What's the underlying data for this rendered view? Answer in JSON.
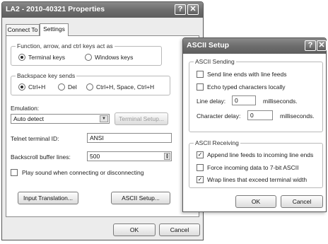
{
  "properties_dialog": {
    "title": "LA2 - 2010-40321 Properties",
    "help_button": "?",
    "close_button": "✕",
    "tabs": [
      {
        "label": "Connect To",
        "active": false
      },
      {
        "label": "Settings",
        "active": true
      }
    ],
    "function_keys": {
      "legend": "Function, arrow, and ctrl keys act as",
      "options": [
        {
          "label": "Terminal keys",
          "selected": true
        },
        {
          "label": "Windows keys",
          "selected": false
        }
      ]
    },
    "backspace": {
      "legend": "Backspace key sends",
      "options": [
        {
          "label": "Ctrl+H",
          "selected": true
        },
        {
          "label": "Del",
          "selected": false
        },
        {
          "label": "Ctrl+H, Space, Ctrl+H",
          "selected": false
        }
      ]
    },
    "emulation": {
      "label": "Emulation:",
      "value": "Auto detect",
      "terminal_setup_label": "Terminal Setup..."
    },
    "telnet_id": {
      "label": "Telnet terminal ID:",
      "value": "ANSI"
    },
    "backscroll": {
      "label": "Backscroll buffer lines:",
      "value": "500"
    },
    "play_sound": {
      "label": "Play sound when connecting or disconnecting",
      "checked": false
    },
    "input_translation_label": "Input Translation...",
    "ascii_setup_label": "ASCII Setup...",
    "ok_label": "OK",
    "cancel_label": "Cancel"
  },
  "ascii_dialog": {
    "title": "ASCII Setup",
    "help_button": "?",
    "close_button": "✕",
    "sending": {
      "legend": "ASCII Sending",
      "send_line_ends": {
        "label": "Send line ends with line feeds",
        "checked": false
      },
      "echo_typed": {
        "label": "Echo typed characters locally",
        "checked": false
      },
      "line_delay": {
        "label": "Line delay:",
        "value": "0",
        "unit": "milliseconds."
      },
      "char_delay": {
        "label": "Character delay:",
        "value": "0",
        "unit": "milliseconds."
      }
    },
    "receiving": {
      "legend": "ASCII Receiving",
      "append_line_feeds": {
        "label": "Append line feeds to incoming line ends",
        "checked": true
      },
      "force_7bit": {
        "label": "Force incoming data to 7-bit ASCII",
        "checked": false
      },
      "wrap_lines": {
        "label": "Wrap lines that exceed terminal width",
        "checked": true
      }
    },
    "ok_label": "OK",
    "cancel_label": "Cancel"
  },
  "check_mark": "✓"
}
